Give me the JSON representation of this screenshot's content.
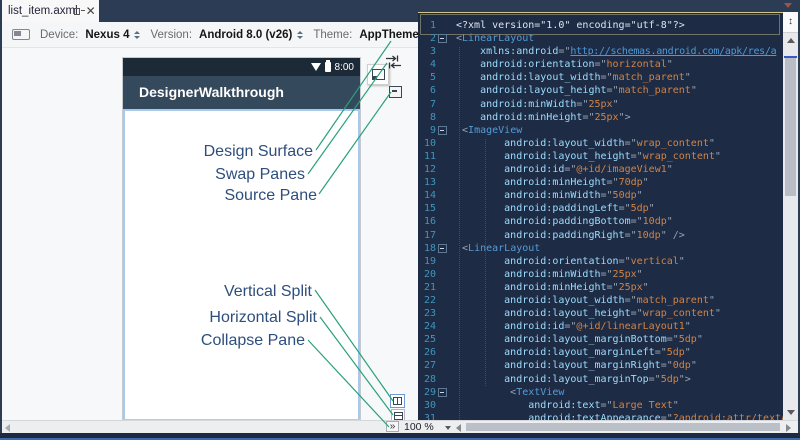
{
  "tab": {
    "title": "list_item.axml"
  },
  "toolbar": {
    "device_label": "Device:",
    "device_value": "Nexus 4",
    "version_label": "Version:",
    "version_value": "Android 8.0 (v26)",
    "theme_label": "Theme:",
    "theme_value": "AppTheme"
  },
  "device_preview": {
    "time": "8:00",
    "app_title": "DesignerWalkthrough"
  },
  "annotations": {
    "design_surface": "Design Surface",
    "swap_panes": "Swap Panes",
    "source_pane": "Source Pane",
    "vertical_split": "Vertical Split",
    "horizontal_split": "Horizontal Split",
    "collapse_pane": "Collapse Pane"
  },
  "status_bar": {
    "zoom_value": "100 %",
    "collapse_glyph": "»",
    "splitter_glyph": "↕"
  },
  "colors": {
    "chrome_navy": "#2c3c55",
    "code_background": "#1d2b44",
    "line_number": "#4096bc",
    "xml_tag": "#569cd6",
    "xml_attribute": "#9cdcfe",
    "xml_value": "#d28445",
    "xml_link": "#4e9ad6",
    "callout_line": "#2aa07a",
    "annotation_text": "#2e4e7d",
    "selected_orientation": "#4a90d8",
    "device_actionbar": "#35495c",
    "selection_border": "#a9c9ea"
  },
  "code": {
    "lines": [
      {
        "n": 1,
        "k": "decl",
        "i": 0,
        "t": "<?xml version=\"1.0\" encoding=\"utf-8\"?>"
      },
      {
        "n": 2,
        "k": "tag",
        "i": 0,
        "t": "LinearLayout",
        "fold": true
      },
      {
        "n": 3,
        "k": "xmlns",
        "i": 4,
        "a": "xmlns:android",
        "v": "http://schemas.android.com/apk/res/a"
      },
      {
        "n": 4,
        "k": "attr",
        "i": 4,
        "a": "android:orientation",
        "v": "horizontal"
      },
      {
        "n": 5,
        "k": "attr",
        "i": 4,
        "a": "android:layout_width",
        "v": "match_parent"
      },
      {
        "n": 6,
        "k": "attr",
        "i": 4,
        "a": "android:layout_height",
        "v": "match_parent"
      },
      {
        "n": 7,
        "k": "attr",
        "i": 4,
        "a": "android:minWidth",
        "v": "25px"
      },
      {
        "n": 8,
        "k": "attr",
        "i": 4,
        "a": "android:minHeight",
        "v": "25px",
        "c": "\">"
      },
      {
        "n": 9,
        "k": "tag",
        "i": 1,
        "t": "ImageView",
        "fold": true
      },
      {
        "n": 10,
        "k": "attr",
        "i": 8,
        "a": "android:layout_width",
        "v": "wrap_content"
      },
      {
        "n": 11,
        "k": "attr",
        "i": 8,
        "a": "android:layout_height",
        "v": "wrap_content"
      },
      {
        "n": 12,
        "k": "attr",
        "i": 8,
        "a": "android:id",
        "v": "@+id/imageView1"
      },
      {
        "n": 13,
        "k": "attr",
        "i": 8,
        "a": "android:minHeight",
        "v": "70dp"
      },
      {
        "n": 14,
        "k": "attr",
        "i": 8,
        "a": "android:minWidth",
        "v": "50dp"
      },
      {
        "n": 15,
        "k": "attr",
        "i": 8,
        "a": "android:paddingLeft",
        "v": "5dp"
      },
      {
        "n": 16,
        "k": "attr",
        "i": 8,
        "a": "android:paddingBottom",
        "v": "10dp"
      },
      {
        "n": 17,
        "k": "attr",
        "i": 8,
        "a": "android:paddingRight",
        "v": "10dp",
        "c": "\" />"
      },
      {
        "n": 18,
        "k": "tag",
        "i": 1,
        "t": "LinearLayout",
        "fold": true
      },
      {
        "n": 19,
        "k": "attr",
        "i": 8,
        "a": "android:orientation",
        "v": "vertical"
      },
      {
        "n": 20,
        "k": "attr",
        "i": 8,
        "a": "android:minWidth",
        "v": "25px"
      },
      {
        "n": 21,
        "k": "attr",
        "i": 8,
        "a": "android:minHeight",
        "v": "25px"
      },
      {
        "n": 22,
        "k": "attr",
        "i": 8,
        "a": "android:layout_width",
        "v": "match_parent"
      },
      {
        "n": 23,
        "k": "attr",
        "i": 8,
        "a": "android:layout_height",
        "v": "wrap_content"
      },
      {
        "n": 24,
        "k": "attr",
        "i": 8,
        "a": "android:id",
        "v": "@+id/linearLayout1"
      },
      {
        "n": 25,
        "k": "attr",
        "i": 8,
        "a": "android:layout_marginBottom",
        "v": "5dp"
      },
      {
        "n": 26,
        "k": "attr",
        "i": 8,
        "a": "android:layout_marginLeft",
        "v": "5dp"
      },
      {
        "n": 27,
        "k": "attr",
        "i": 8,
        "a": "android:layout_marginRight",
        "v": "0dp"
      },
      {
        "n": 28,
        "k": "attr",
        "i": 8,
        "a": "android:layout_marginTop",
        "v": "5dp",
        "c": "\">"
      },
      {
        "n": 29,
        "k": "tag",
        "i": 9,
        "t": "TextView",
        "fold": true
      },
      {
        "n": 30,
        "k": "attr",
        "i": 12,
        "a": "android:text",
        "v": "Large Text"
      },
      {
        "n": 31,
        "k": "attr",
        "i": 12,
        "a": "android:textAppearance",
        "v": "?android:attr/textA",
        "c": ""
      }
    ]
  }
}
